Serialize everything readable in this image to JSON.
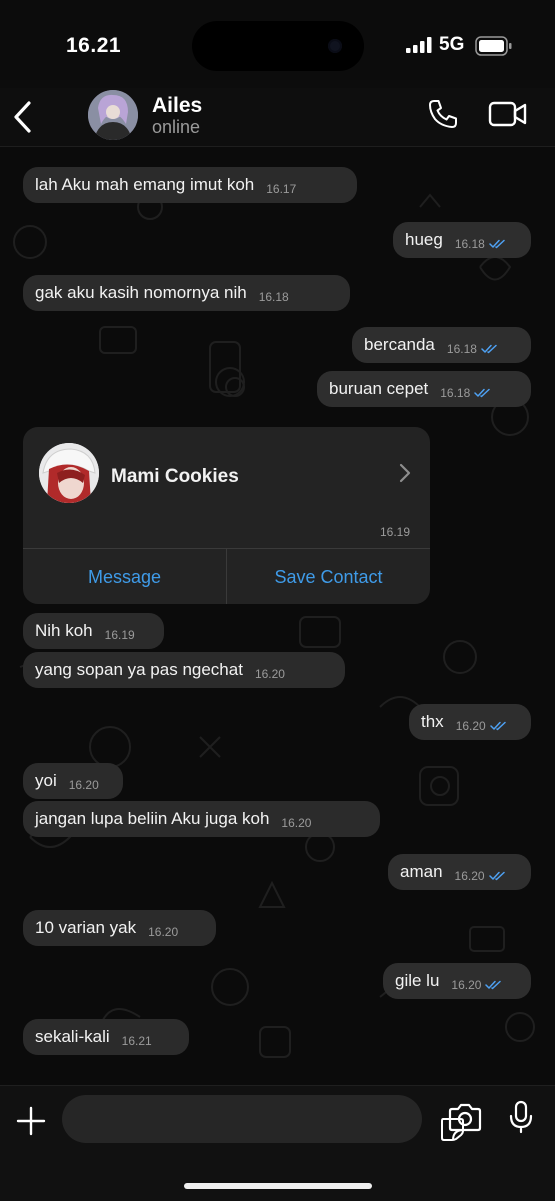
{
  "status_bar": {
    "time": "16.21",
    "network": "5G"
  },
  "header": {
    "name": "Ailes",
    "status": "online"
  },
  "messages": [
    {
      "dir": "in",
      "text": "lah Aku mah emang imut koh",
      "time": "16.17"
    },
    {
      "dir": "out",
      "text": "hueg",
      "time": "16.18",
      "read": true
    },
    {
      "dir": "in",
      "text": "gak aku kasih nomornya nih",
      "time": "16.18"
    },
    {
      "dir": "out",
      "text": "bercanda",
      "time": "16.18",
      "read": true
    },
    {
      "dir": "out",
      "text": "buruan cepet",
      "time": "16.18",
      "read": true
    },
    {
      "dir": "in",
      "text": "Nih koh",
      "time": "16.19"
    },
    {
      "dir": "in",
      "text": "yang sopan ya pas ngechat",
      "time": "16.20"
    },
    {
      "dir": "out",
      "text": "thx",
      "time": "16.20",
      "read": true
    },
    {
      "dir": "in",
      "text": "yoi",
      "time": "16.20"
    },
    {
      "dir": "in",
      "text": "jangan lupa beliin Aku juga koh",
      "time": "16.20"
    },
    {
      "dir": "out",
      "text": "aman",
      "time": "16.20",
      "read": true
    },
    {
      "dir": "in",
      "text": "10 varian yak",
      "time": "16.20"
    },
    {
      "dir": "out",
      "text": "gile lu",
      "time": "16.20",
      "read": true
    },
    {
      "dir": "in",
      "text": "sekali-kali",
      "time": "16.21"
    }
  ],
  "contact_card": {
    "name": "Mami Cookies",
    "time": "16.19",
    "message_label": "Message",
    "save_label": "Save Contact"
  },
  "colors": {
    "accent": "#3f9be8",
    "read_ticks": "#4ea1f3",
    "bubble": "#2b2b2b",
    "background": "#0b0b0b"
  }
}
